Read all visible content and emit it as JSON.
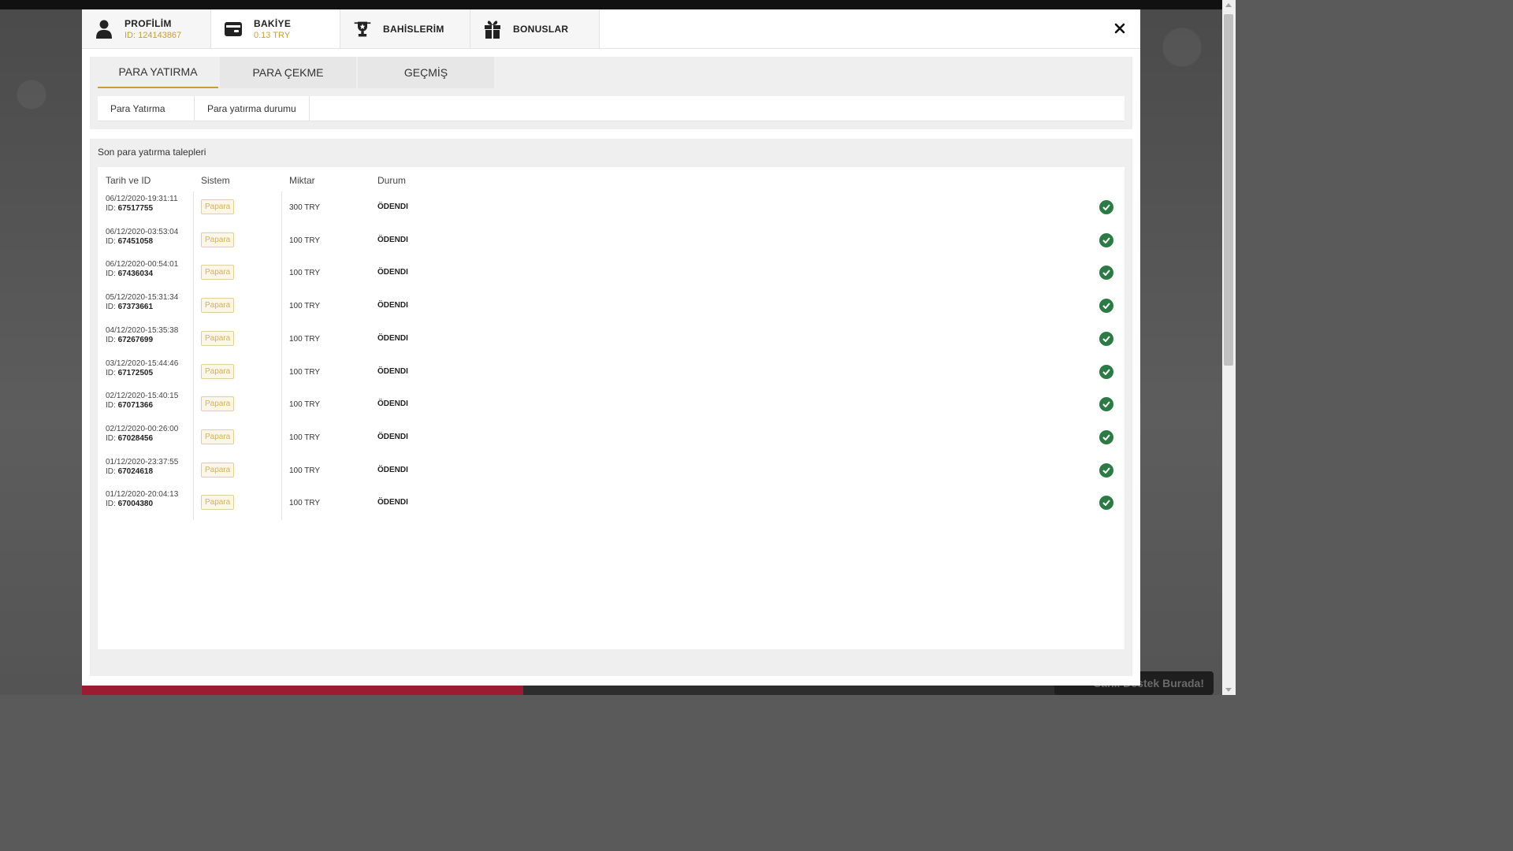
{
  "header": {
    "tabs": [
      {
        "label": "PROFİLİM",
        "sub": "ID: 124143867",
        "icon": "user-icon"
      },
      {
        "label": "BAKİYE",
        "sub": "0.13 TRY",
        "icon": "wallet-icon"
      },
      {
        "label": "BAHİSLERİM",
        "sub": "",
        "icon": "trophy-icon"
      },
      {
        "label": "BONUSLAR",
        "sub": "",
        "icon": "gift-icon"
      }
    ],
    "active_tab": "BAKİYE",
    "close_icon": "close-icon"
  },
  "sub_tabs": [
    "PARA YATIRMA",
    "PARA ÇEKME",
    "GEÇMİŞ"
  ],
  "active_sub_tab": "PARA YATIRMA",
  "secondary_tabs": [
    "Para Yatırma",
    "Para yatırma durumu"
  ],
  "section_title": "Son para yatırma talepleri",
  "table": {
    "headers": [
      "Tarih ve ID",
      "Sistem",
      "Miktar",
      "Durum"
    ],
    "rows": [
      {
        "datetime": "06/12/2020-19:31:11",
        "id_prefix": "ID:",
        "id": "67517755",
        "system": "Papara",
        "amount": "300 TRY",
        "status": "ÖDENDI"
      },
      {
        "datetime": "06/12/2020-03:53:04",
        "id_prefix": "ID:",
        "id": "67451058",
        "system": "Papara",
        "amount": "100 TRY",
        "status": "ÖDENDI"
      },
      {
        "datetime": "06/12/2020-00:54:01",
        "id_prefix": "ID:",
        "id": "67436034",
        "system": "Papara",
        "amount": "100 TRY",
        "status": "ÖDENDI"
      },
      {
        "datetime": "05/12/2020-15:31:34",
        "id_prefix": "ID:",
        "id": "67373661",
        "system": "Papara",
        "amount": "100 TRY",
        "status": "ÖDENDI"
      },
      {
        "datetime": "04/12/2020-15:35:38",
        "id_prefix": "ID:",
        "id": "67267699",
        "system": "Papara",
        "amount": "100 TRY",
        "status": "ÖDENDI"
      },
      {
        "datetime": "03/12/2020-15:44:46",
        "id_prefix": "ID:",
        "id": "67172505",
        "system": "Papara",
        "amount": "100 TRY",
        "status": "ÖDENDI"
      },
      {
        "datetime": "02/12/2020-15:40:15",
        "id_prefix": "ID:",
        "id": "67071366",
        "system": "Papara",
        "amount": "100 TRY",
        "status": "ÖDENDI"
      },
      {
        "datetime": "02/12/2020-00:26:00",
        "id_prefix": "ID:",
        "id": "67028456",
        "system": "Papara",
        "amount": "100 TRY",
        "status": "ÖDENDI"
      },
      {
        "datetime": "01/12/2020-23:37:55",
        "id_prefix": "ID:",
        "id": "67024618",
        "system": "Papara",
        "amount": "100 TRY",
        "status": "ÖDENDI"
      },
      {
        "datetime": "01/12/2020-20:04:13",
        "id_prefix": "ID:",
        "id": "67004380",
        "system": "Papara",
        "amount": "100 TRY",
        "status": "ÖDENDI"
      }
    ]
  },
  "background": {
    "chat_button": "Canlı Destek Burada!"
  },
  "colors": {
    "accent_gold": "#c9a02e",
    "success_green": "#2c7a45"
  }
}
